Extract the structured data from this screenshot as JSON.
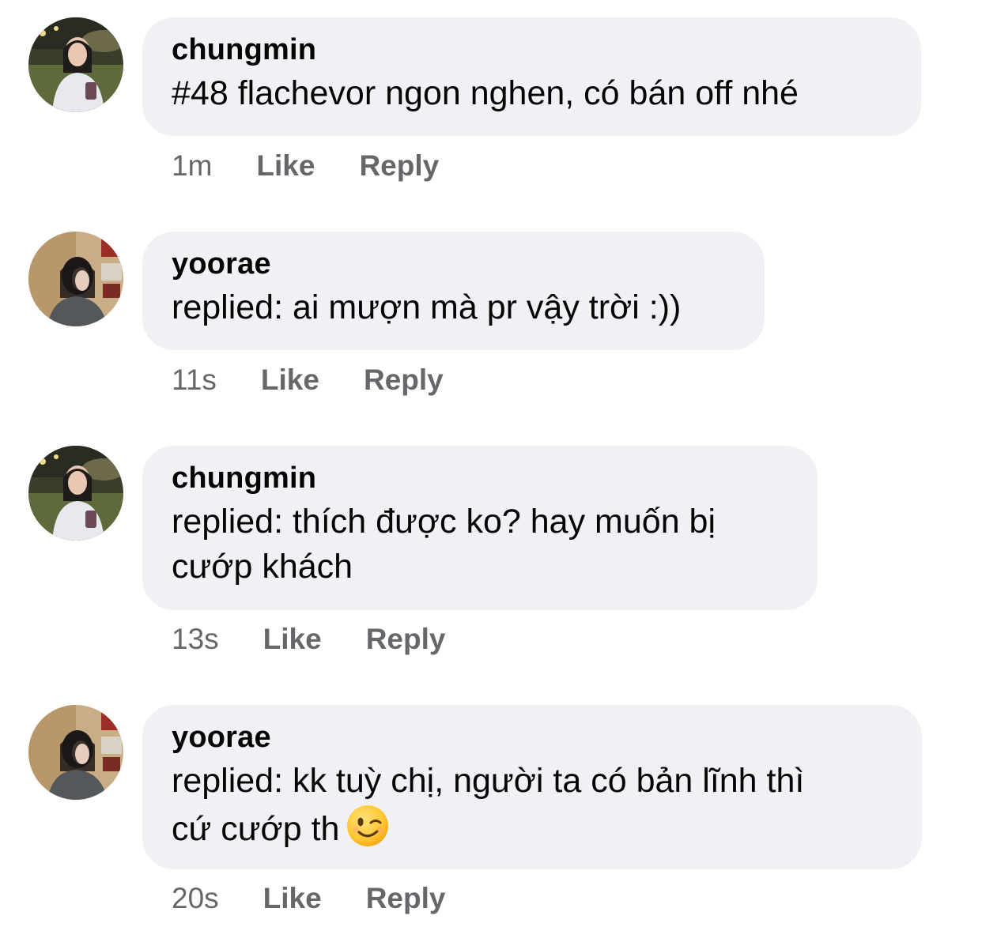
{
  "comments": [
    {
      "author": "chungmin",
      "text": "#48 flachevor ngon nghen, có bán off nhé",
      "time": "1m",
      "like_label": "Like",
      "reply_label": "Reply",
      "avatar": "avatar-chungmin"
    },
    {
      "author": "yoorae",
      "text": "replied: ai mượn mà pr vậy trời :))",
      "time": "11s",
      "like_label": "Like",
      "reply_label": "Reply",
      "avatar": "avatar-yoorae"
    },
    {
      "author": "chungmin",
      "text_line1": "replied: thích được ko? hay muốn bị",
      "text_line2": "cướp khách",
      "time": "13s",
      "like_label": "Like",
      "reply_label": "Reply",
      "avatar": "avatar-chungmin"
    },
    {
      "author": "yoorae",
      "text_line1": "replied: kk tuỳ chị, người ta có bản lĩnh thì",
      "text_line2": "cứ cướp th",
      "emoji": "winking-face-emoji",
      "time": "20s",
      "like_label": "Like",
      "reply_label": "Reply",
      "avatar": "avatar-yoorae"
    }
  ],
  "colors": {
    "bubble": "#f0f1f5",
    "text": "#050505",
    "secondary": "#65676b"
  }
}
